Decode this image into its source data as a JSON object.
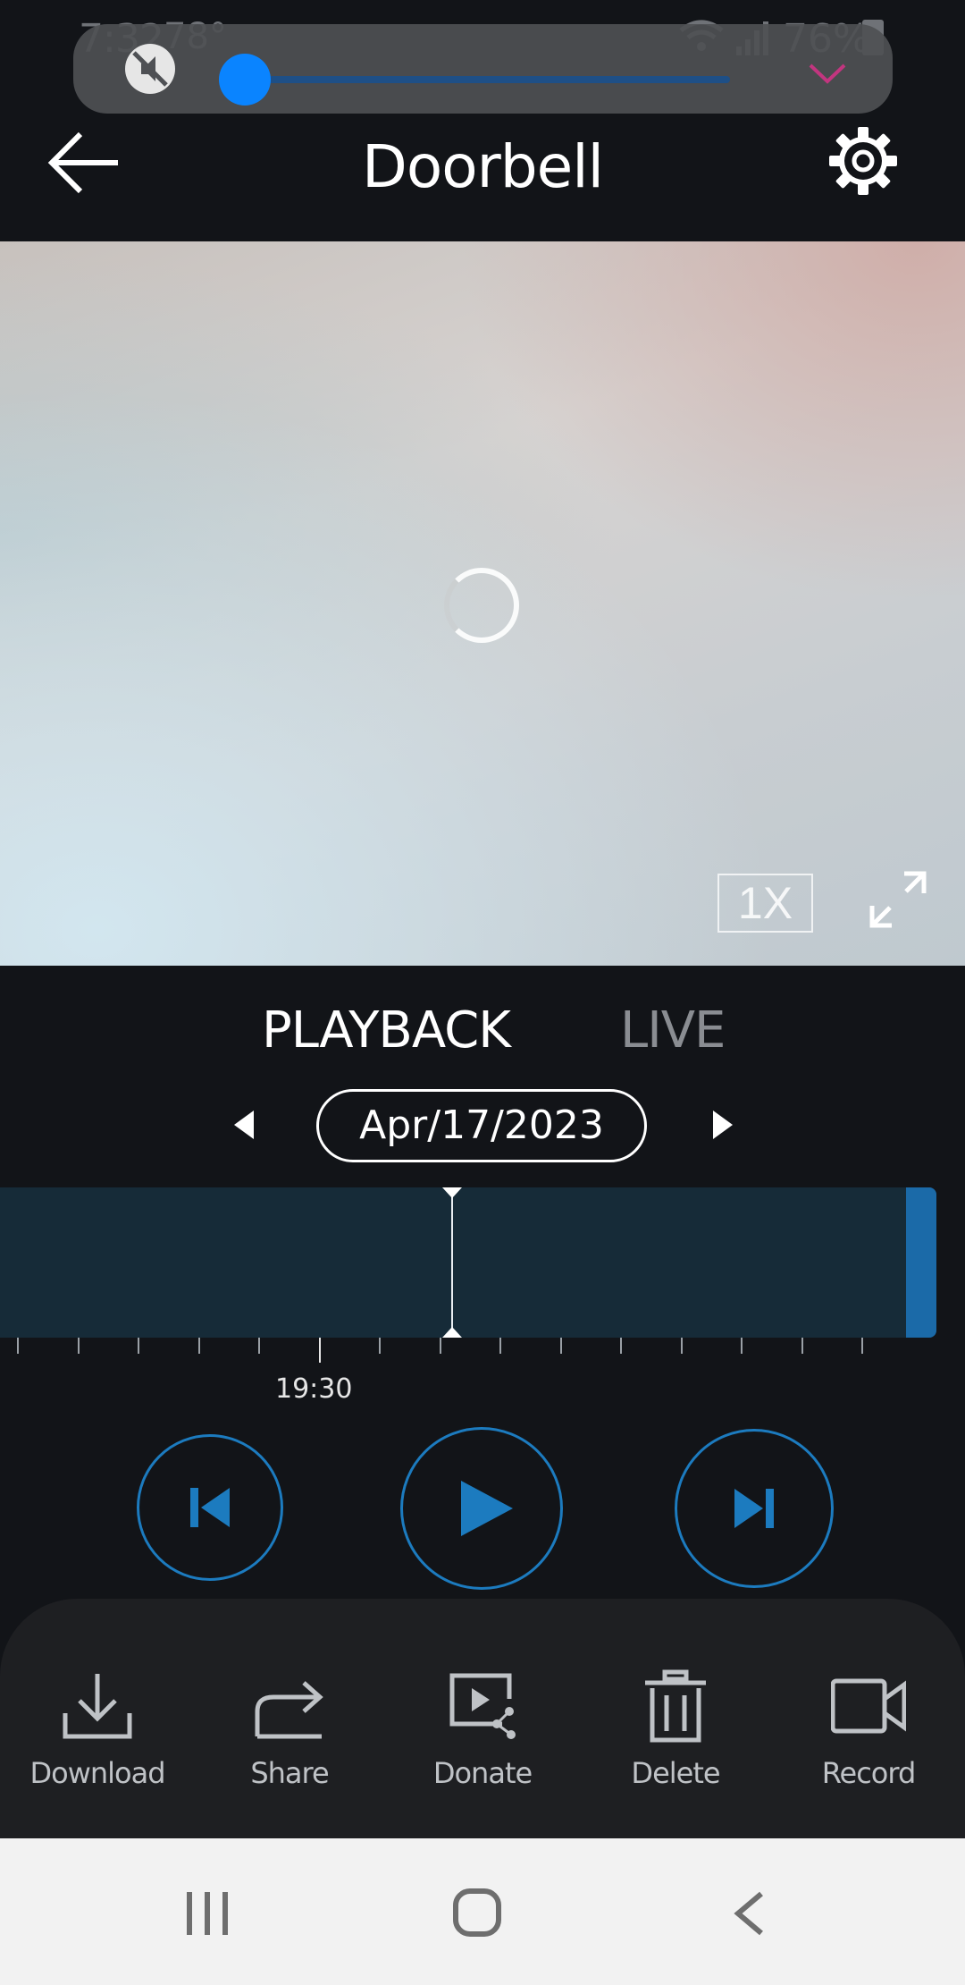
{
  "status_bar": {
    "time": "7:32",
    "temperature": "78°",
    "battery": "76%"
  },
  "volume_overlay": {
    "level": 0.0,
    "muted": true,
    "accent_color": "#0a84ff",
    "chevron_color": "#c2357f"
  },
  "header": {
    "title": "Doorbell"
  },
  "video": {
    "speed": "1X",
    "loading": true
  },
  "mode_tabs": {
    "playback": "PLAYBACK",
    "live": "LIVE",
    "active": "PLAYBACK"
  },
  "date_picker": {
    "date": "Apr/17/2023"
  },
  "timeline": {
    "time_label": "19:30",
    "colors": {
      "track": "#162b38",
      "recorded": "#1b6aa8",
      "playhead": "#e9eef2"
    }
  },
  "controls": {
    "accent": "#1c7bbf",
    "buttons": [
      "skip-previous",
      "play",
      "skip-next"
    ]
  },
  "actions": [
    {
      "label": "Download",
      "icon": "download-icon"
    },
    {
      "label": "Share",
      "icon": "share-icon"
    },
    {
      "label": "Donate",
      "icon": "donate-icon"
    },
    {
      "label": "Delete",
      "icon": "trash-icon"
    },
    {
      "label": "Record",
      "icon": "video-camera-icon"
    }
  ],
  "nav_bar": {
    "buttons": [
      "recents",
      "home",
      "back"
    ]
  }
}
